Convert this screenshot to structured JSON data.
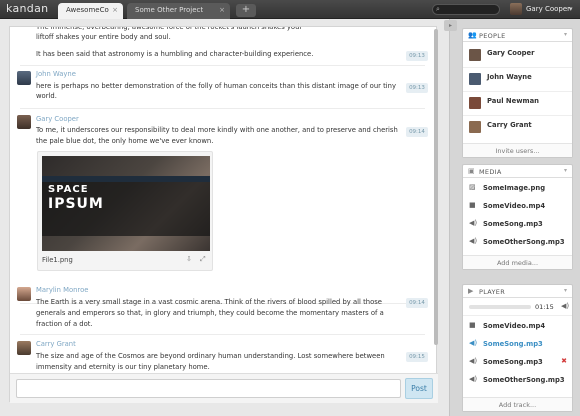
{
  "app": {
    "logo": "kandan",
    "tabs": [
      {
        "label": "AwesomeCo",
        "close": "×"
      },
      {
        "label": "Some Other Project",
        "close": "×"
      }
    ],
    "new_tab": "+",
    "search_icon": "⌕",
    "user": {
      "name": "Gary Cooper",
      "dropdown": "▾"
    }
  },
  "chat": {
    "messages": [
      {
        "text1": "liftoff shakes your entire body and soul.",
        "text2": "It has been said that astronomy is a humbling and character-building experience.",
        "time": "09:13"
      },
      {
        "author": "John Wayne",
        "text": "here is perhaps no better demonstration of the folly of human conceits than this distant image of our tiny",
        "text2": "world.",
        "time": "09:13"
      },
      {
        "author": "Gary Cooper",
        "text": "To me, it underscores our responsibility to deal more kindly with one another, and to preserve and cherish",
        "text2": "the pale blue dot, the only home we've ever known.",
        "time": "09:14",
        "attachment": {
          "name": "File1.png",
          "thumb_title_1": "SPACE",
          "thumb_title_2": "IPSUM",
          "download_icon": "⇩",
          "expand_icon": "⤢"
        }
      },
      {
        "author": "Marylin Monroe",
        "text": "The Earth is a very small stage in a vast cosmic arena. Think of the rivers of blood spilled by all those",
        "text2": "generals and emperors so that, in glory and triumph, they could become the momentary masters of a",
        "text3": "fraction of a dot.",
        "time": "09:14"
      },
      {
        "author": "Carry Grant",
        "text": "The size and age of the Cosmos are beyond ordinary human understanding. Lost somewhere between",
        "text2": "immensity and eternity is our tiny planetary home.",
        "time": "09:15"
      }
    ],
    "composer": {
      "placeholder": "",
      "post_label": "Post"
    }
  },
  "sidebar": {
    "collapse_icon": "▸",
    "people": {
      "icon": "👥",
      "title": "PEOPLE",
      "dropdown": "▾",
      "items": [
        {
          "name": "Gary Cooper",
          "color": "#6b5547"
        },
        {
          "name": "John Wayne",
          "color": "#4a5a70"
        },
        {
          "name": "Paul Newman",
          "color": "#7a4a3a"
        },
        {
          "name": "Carry Grant",
          "color": "#8a6a50"
        }
      ],
      "footer": "Invite users..."
    },
    "media": {
      "icon": "▣",
      "title": "MEDIA",
      "dropdown": "▾",
      "items": [
        {
          "name": "SomeImage.png",
          "icon": "▨"
        },
        {
          "name": "SomeVideo.mp4",
          "icon": "■"
        },
        {
          "name": "SomeSong.mp3",
          "icon": "◀)"
        },
        {
          "name": "SomeOtherSong.mp3",
          "icon": "◀)"
        }
      ],
      "footer": "Add media..."
    },
    "player": {
      "icon": "▶",
      "title": "PLAYER",
      "dropdown": "▾",
      "progress": 0.0,
      "time": "01:15",
      "volume_icon": "◀)",
      "items": [
        {
          "name": "SomeVideo.mp4",
          "icon": "■",
          "playing": false
        },
        {
          "name": "SomeSong.mp3",
          "icon": "◀)",
          "playing": true
        },
        {
          "name": "SomeSong.mp3",
          "icon": "◀)",
          "playing": false,
          "remove": "✖"
        },
        {
          "name": "SomeOtherSong.mp3",
          "icon": "◀)",
          "playing": false
        }
      ],
      "footer": "Add track..."
    }
  }
}
